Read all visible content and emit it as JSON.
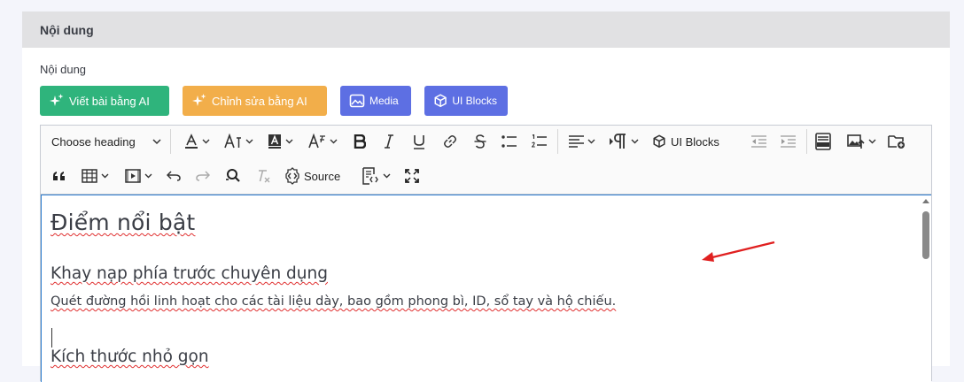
{
  "section": {
    "header_title": "Nội dung",
    "field_label": "Nội dung"
  },
  "actions": {
    "ai_write": "Viết bài bằng AI",
    "ai_edit": "Chỉnh sửa bằng AI",
    "media": "Media",
    "ui_blocks": "UI Blocks"
  },
  "toolbar": {
    "heading_select": "Choose heading",
    "ui_blocks": "UI Blocks",
    "source": "Source"
  },
  "document": {
    "title": "Điểm nổi bật",
    "heading_1": "Khay nạp phía trước chuyên dụng",
    "paragraph_1": "Quét đường hồi linh hoạt cho các tài liệu dày, bao gồm phong bì, ID, sổ tay và hộ chiếu.",
    "heading_2": "Kích thước nhỏ gọn"
  },
  "colors": {
    "ai_button": "#2fb47c",
    "edit_button": "#f2ae4a",
    "media_button": "#5d6fe3",
    "annotation_arrow": "#e02020",
    "focus_border": "#2f7fd0"
  }
}
